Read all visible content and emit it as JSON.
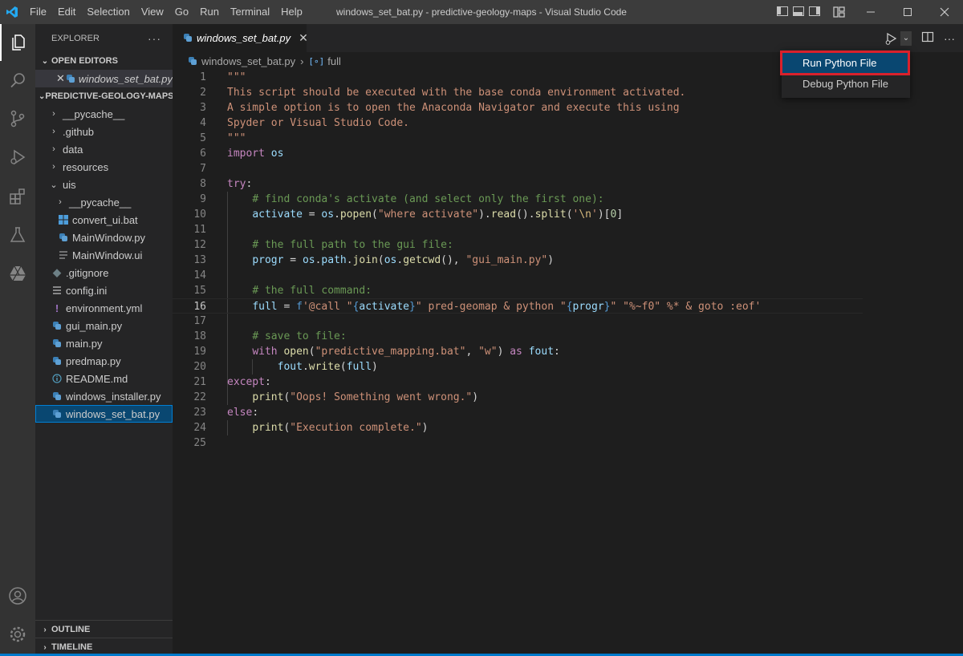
{
  "window": {
    "title": "windows_set_bat.py - predictive-geology-maps - Visual Studio Code",
    "menu": [
      "File",
      "Edit",
      "Selection",
      "View",
      "Go",
      "Run",
      "Terminal",
      "Help"
    ]
  },
  "sidebar": {
    "header": "EXPLORER",
    "open_editors_label": "OPEN EDITORS",
    "open_editor_file": "windows_set_bat.py",
    "project_label": "PREDICTIVE-GEOLOGY-MAPS",
    "tree": [
      {
        "label": "__pycache__",
        "type": "folder",
        "depth": 0,
        "expanded": false
      },
      {
        "label": ".github",
        "type": "folder",
        "depth": 0,
        "expanded": false
      },
      {
        "label": "data",
        "type": "folder",
        "depth": 0,
        "expanded": false
      },
      {
        "label": "resources",
        "type": "folder",
        "depth": 0,
        "expanded": false
      },
      {
        "label": "uis",
        "type": "folder",
        "depth": 0,
        "expanded": true
      },
      {
        "label": "__pycache__",
        "type": "folder",
        "depth": 1,
        "expanded": false
      },
      {
        "label": "convert_ui.bat",
        "type": "bat",
        "depth": 1
      },
      {
        "label": "MainWindow.py",
        "type": "py",
        "depth": 1
      },
      {
        "label": "MainWindow.ui",
        "type": "ui",
        "depth": 1
      },
      {
        "label": ".gitignore",
        "type": "gitignore",
        "depth": 0
      },
      {
        "label": "config.ini",
        "type": "ini",
        "depth": 0
      },
      {
        "label": "environment.yml",
        "type": "yml",
        "depth": 0
      },
      {
        "label": "gui_main.py",
        "type": "py",
        "depth": 0
      },
      {
        "label": "main.py",
        "type": "py",
        "depth": 0
      },
      {
        "label": "predmap.py",
        "type": "py",
        "depth": 0
      },
      {
        "label": "README.md",
        "type": "md",
        "depth": 0
      },
      {
        "label": "windows_installer.py",
        "type": "py",
        "depth": 0
      },
      {
        "label": "windows_set_bat.py",
        "type": "py",
        "depth": 0,
        "selected": true
      }
    ],
    "outline_label": "OUTLINE",
    "timeline_label": "TIMELINE"
  },
  "editor": {
    "tab_label": "windows_set_bat.py",
    "breadcrumb": {
      "file": "windows_set_bat.py",
      "symbol": "full"
    },
    "current_line": 16
  },
  "run_menu": {
    "items": [
      "Run Python File",
      "Debug Python File"
    ],
    "selected_index": 0
  },
  "colors": {
    "accent": "#007acc",
    "highlight_box": "#d9212c",
    "selection": "#094771"
  }
}
